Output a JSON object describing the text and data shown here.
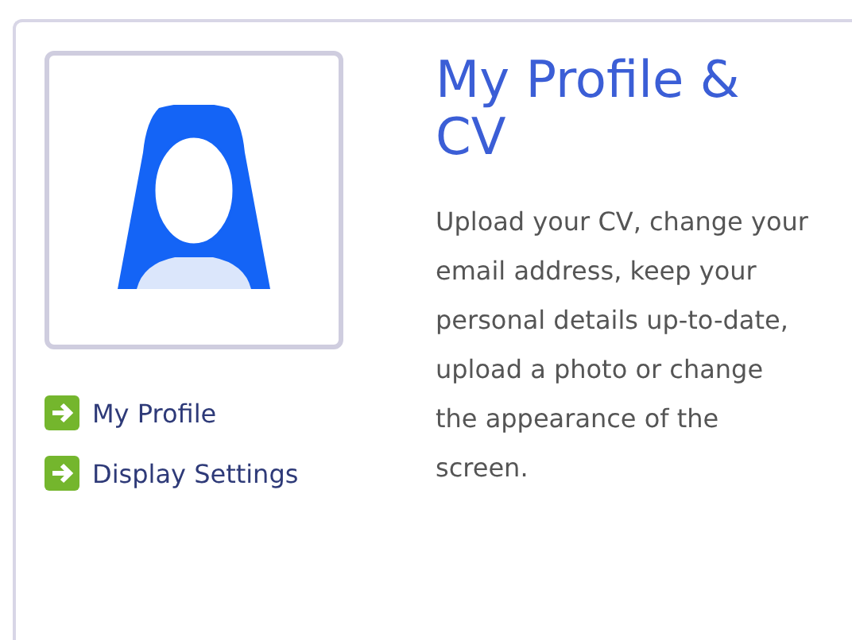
{
  "card": {
    "title": "My Profile & CV",
    "links": [
      {
        "label": "My Profile"
      },
      {
        "label": "Display Settings"
      }
    ],
    "description": "Upload your CV, change your email address, keep your personal details up-to-date, upload a photo or change the appearance of the screen."
  }
}
